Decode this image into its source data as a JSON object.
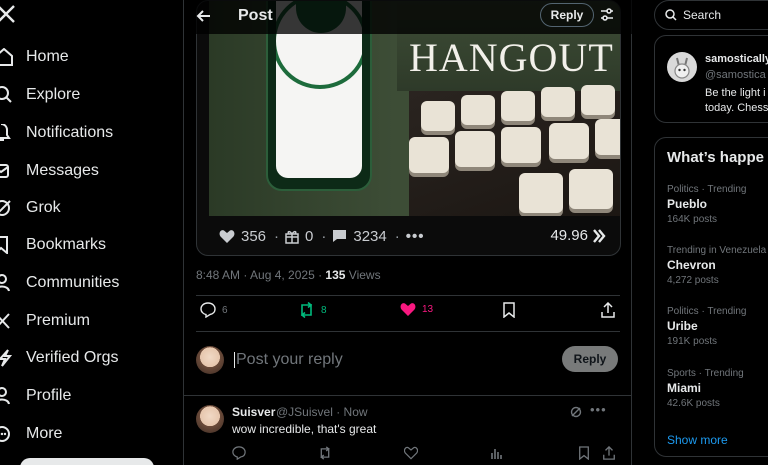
{
  "nav": {
    "items": [
      {
        "label": "Home"
      },
      {
        "label": "Explore"
      },
      {
        "label": "Notifications"
      },
      {
        "label": "Messages"
      },
      {
        "label": "Grok"
      },
      {
        "label": "Bookmarks"
      },
      {
        "label": "Communities"
      },
      {
        "label": "Premium"
      },
      {
        "label": "Verified Orgs"
      },
      {
        "label": "Profile"
      },
      {
        "label": "More"
      }
    ]
  },
  "header": {
    "title": "Post",
    "reply_label": "Reply"
  },
  "embed": {
    "image_text": "HANGOUT",
    "stats": {
      "likes": "356",
      "gifts": "0",
      "comments": "3234",
      "payout": "49.96"
    }
  },
  "post": {
    "time": "8:48 AM · Aug 4, 2025 · ",
    "views_count": "135",
    "views_label": " Views"
  },
  "actions": {
    "replies": "6",
    "reposts": "8",
    "likes": "13"
  },
  "compose": {
    "placeholder": "Post your reply",
    "button": "Reply"
  },
  "reply": {
    "name": "Suisver",
    "handle": "@JSuisvel · Now",
    "text": "wow incredible, that's great"
  },
  "search": {
    "placeholder": "Search"
  },
  "follow_card": {
    "name": "samostically",
    "handle": "@samostica",
    "bio1": "Be the light i",
    "bio2": "today. Chess"
  },
  "trends": {
    "title": "What’s happe",
    "items": [
      {
        "context": "Politics · Trending",
        "topic": "Pueblo",
        "count": "164K posts"
      },
      {
        "context": "Trending in Venezuela",
        "topic": "Chevron",
        "count": "4,272 posts"
      },
      {
        "context": "Politics · Trending",
        "topic": "Uribe",
        "count": "191K posts"
      },
      {
        "context": "Sports · Trending",
        "topic": "Miami",
        "count": "42.6K posts"
      }
    ],
    "show_more": "Show more"
  },
  "colors": {
    "like_pink": "#f91880",
    "repost_green": "#00ba7c",
    "link_blue": "#1d9bf0"
  }
}
